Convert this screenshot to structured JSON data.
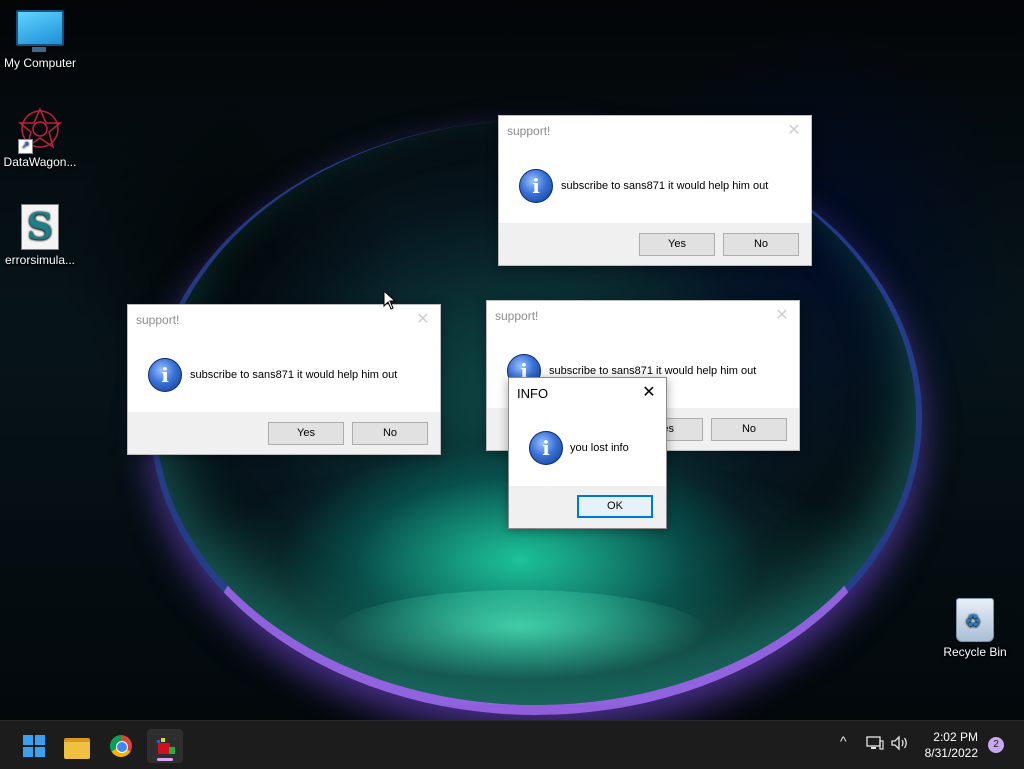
{
  "desktop": {
    "icons": [
      {
        "label": "My Computer",
        "icon": "monitor-icon"
      },
      {
        "label": "DataWagon...",
        "icon": "datawagon-icon"
      },
      {
        "label": "errorsimula...",
        "icon": "script-file-icon"
      },
      {
        "label": "Recycle Bin",
        "icon": "recycle-bin-icon"
      }
    ]
  },
  "dialogs": {
    "support_title": "support!",
    "support_message": "subscribe to sans871 it would help him out",
    "yes_label": "Yes",
    "no_label": "No",
    "info_title": "INFO",
    "info_message": "you lost info",
    "ok_label": "OK",
    "info_glyph": "i",
    "close_glyph": "✕"
  },
  "taskbar": {
    "apps": [
      "start-button",
      "file-explorer",
      "chrome",
      "errorsimulator"
    ],
    "tray": {
      "chevron": "^",
      "network": "network-icon",
      "volume": "volume-icon"
    },
    "time": "2:02 PM",
    "date": "8/31/2022",
    "notification_count": "2"
  },
  "colors": {
    "accent": "#0078d7",
    "taskbar": "#1c1c1c",
    "badge": "#c7a9f0"
  }
}
